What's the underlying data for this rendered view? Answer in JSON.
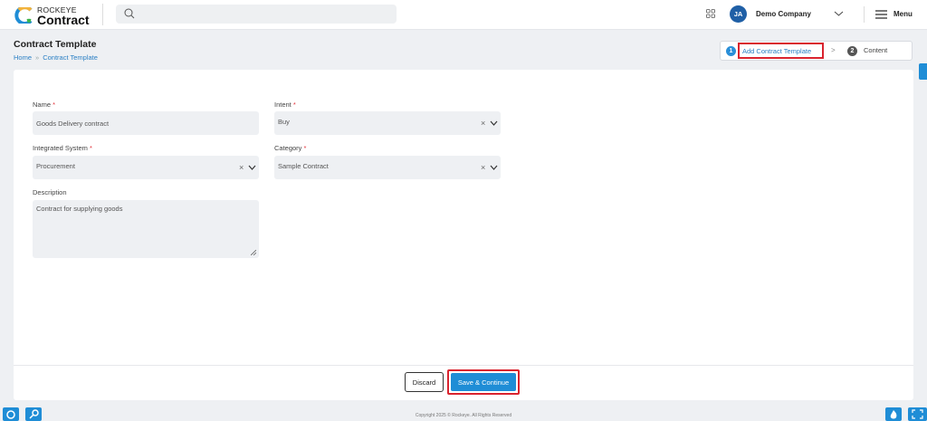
{
  "header": {
    "brand_small": "ROCKEYE",
    "brand_big": "Contract",
    "avatar_initials": "JA",
    "company": "Demo Company",
    "menu_label": "Menu"
  },
  "page": {
    "title": "Contract Template",
    "breadcrumb": [
      "Home",
      "Contract Template"
    ]
  },
  "steps": [
    {
      "num": "1",
      "label": "Add Contract Template"
    },
    {
      "num": "2",
      "label": "Content"
    }
  ],
  "form": {
    "name_label": "Name",
    "name_value": "Goods Delivery contract",
    "intent_label": "Intent",
    "intent_value": "Buy",
    "integrated_system_label": "Integrated System",
    "integrated_system_value": "Procurement",
    "category_label": "Category",
    "category_value": "Sample Contract",
    "description_label": "Description",
    "description_value": "Contract for supplying goods",
    "required_mark": "*",
    "clear_glyph": "×"
  },
  "actions": {
    "discard": "Discard",
    "save": "Save & Continue"
  },
  "footer": {
    "copyright": "Copyright 2025 © Rockeye. All Rights Reserved"
  },
  "colors": {
    "accent": "#1f8dd6",
    "highlight": "#d9232e",
    "avatar": "#1f5fa6"
  }
}
